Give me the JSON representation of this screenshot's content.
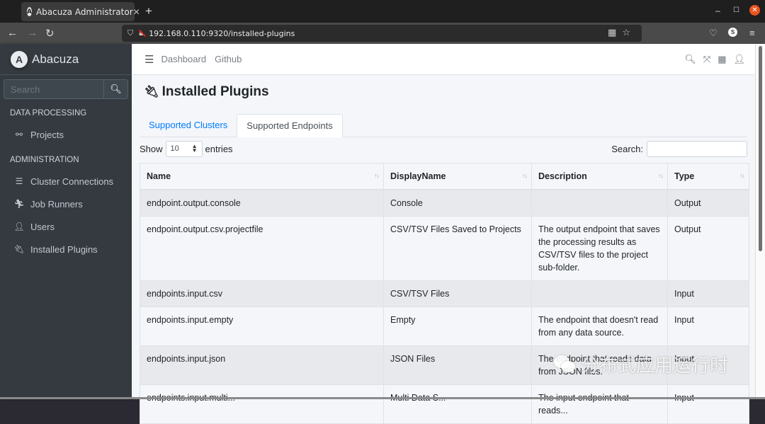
{
  "browser": {
    "tab_title": "Abacuza Administrator",
    "tab_favicon": "A",
    "url": "192.168.0.110:9320/installed-plugins",
    "profile_initial": "S"
  },
  "sidebar": {
    "brand": "Abacuza",
    "brand_logo": "A",
    "search_placeholder": "Search",
    "sections": [
      {
        "header": "DATA PROCESSING",
        "items": [
          {
            "label": "Projects",
            "icon": "project-diagram-icon"
          }
        ]
      },
      {
        "header": "ADMINISTRATION",
        "items": [
          {
            "label": "Cluster Connections",
            "icon": "server-icon"
          },
          {
            "label": "Job Runners",
            "icon": "running-icon"
          },
          {
            "label": "Users",
            "icon": "user-icon"
          },
          {
            "label": "Installed Plugins",
            "icon": "plug-icon"
          }
        ]
      }
    ]
  },
  "topnav": {
    "links": [
      "Dashboard",
      "Github"
    ]
  },
  "page": {
    "title": "Installed Plugins",
    "tabs": [
      {
        "label": "Supported Clusters",
        "active": false
      },
      {
        "label": "Supported Endpoints",
        "active": true
      }
    ],
    "show_label": "Show",
    "entries_value": "10",
    "entries_label": "entries",
    "search_label": "Search:",
    "search_value": ""
  },
  "table": {
    "columns": [
      "Name",
      "DisplayName",
      "Description",
      "Type"
    ],
    "rows": [
      {
        "name": "endpoint.output.console",
        "display": "Console",
        "description": "",
        "type": "Output"
      },
      {
        "name": "endpoint.output.csv.projectfile",
        "display": "CSV/TSV Files Saved to Projects",
        "description": "The output endpoint that saves the processing results as CSV/TSV files to the project sub-folder.",
        "type": "Output"
      },
      {
        "name": "endpoints.input.csv",
        "display": "CSV/TSV Files",
        "description": "",
        "type": "Input"
      },
      {
        "name": "endpoints.input.empty",
        "display": "Empty",
        "description": "The endpoint that doesn't read from any data source.",
        "type": "Input"
      },
      {
        "name": "endpoints.input.json",
        "display": "JSON Files",
        "description": "The endpoint that reads data from JSON files.",
        "type": "Input"
      },
      {
        "name": "endpoints.input.multi...",
        "display": "Multi Data S...",
        "description": "The input endpoint that reads...",
        "type": "Input"
      }
    ]
  },
  "watermark": "分布式应用运行时"
}
